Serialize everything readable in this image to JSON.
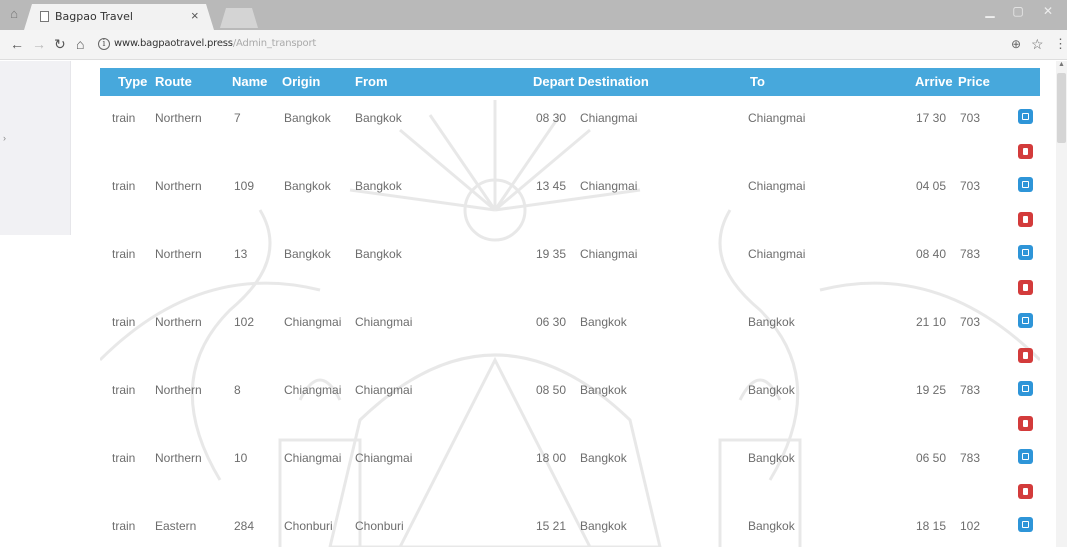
{
  "browser": {
    "tab_title": "Bagpao Travel",
    "tab_close": "×",
    "url_host": "www.bagpaotravel.press",
    "url_path": "/Admin_transport"
  },
  "table": {
    "headers": [
      "Type",
      "Route",
      "Name",
      "Origin",
      "From",
      "Depart",
      "Destination",
      "To",
      "Arrive",
      "Price"
    ],
    "rows": [
      {
        "type": "train",
        "route": "Northern",
        "name": "7",
        "origin": "Bangkok",
        "from": "Bangkok",
        "depart": "08 30",
        "destination": "Chiangmai",
        "to": "Chiangmai",
        "arrive": "17 30",
        "price": "703"
      },
      {
        "type": "train",
        "route": "Northern",
        "name": "109",
        "origin": "Bangkok",
        "from": "Bangkok",
        "depart": "13 45",
        "destination": "Chiangmai",
        "to": "Chiangmai",
        "arrive": "04 05",
        "price": "703"
      },
      {
        "type": "train",
        "route": "Northern",
        "name": "13",
        "origin": "Bangkok",
        "from": "Bangkok",
        "depart": "19 35",
        "destination": "Chiangmai",
        "to": "Chiangmai",
        "arrive": "08 40",
        "price": "783"
      },
      {
        "type": "train",
        "route": "Northern",
        "name": "102",
        "origin": "Chiangmai",
        "from": "Chiangmai",
        "depart": "06 30",
        "destination": "Bangkok",
        "to": "Bangkok",
        "arrive": "21 10",
        "price": "703"
      },
      {
        "type": "train",
        "route": "Northern",
        "name": "8",
        "origin": "Chiangmai",
        "from": "Chiangmai",
        "depart": "08 50",
        "destination": "Bangkok",
        "to": "Bangkok",
        "arrive": "19 25",
        "price": "783"
      },
      {
        "type": "train",
        "route": "Northern",
        "name": "10",
        "origin": "Chiangmai",
        "from": "Chiangmai",
        "depart": "18 00",
        "destination": "Bangkok",
        "to": "Bangkok",
        "arrive": "06 50",
        "price": "783"
      },
      {
        "type": "train",
        "route": "Eastern",
        "name": "284",
        "origin": "Chonburi",
        "from": "Chonburi",
        "depart": "15 21",
        "destination": "Bangkok",
        "to": "Bangkok",
        "arrive": "18 15",
        "price": "102"
      }
    ]
  },
  "icons": {
    "edit": "edit-icon",
    "delete": "trash-icon",
    "back": "arrow-left-icon",
    "forward": "arrow-right-icon",
    "reload": "reload-icon",
    "home": "home-icon",
    "info": "info-icon",
    "zoom": "zoom-icon",
    "bookmark": "star-icon",
    "menu": "kebab-menu-icon"
  },
  "colors": {
    "header_bg": "#47a8dc",
    "edit_button": "#2e95d8",
    "delete_button": "#d33b3b"
  }
}
